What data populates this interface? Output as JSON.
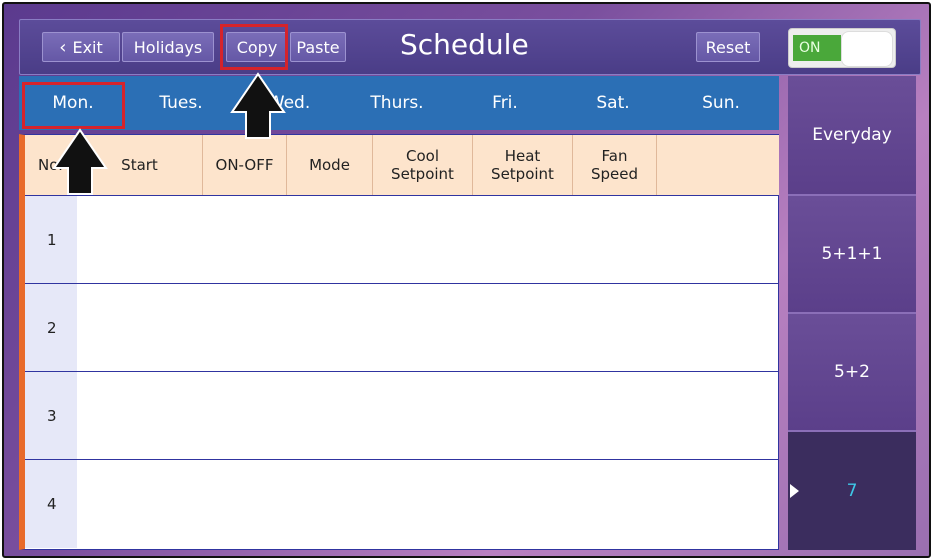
{
  "topbar": {
    "exit_label": "Exit",
    "holidays_label": "Holidays",
    "copy_label": "Copy",
    "paste_label": "Paste",
    "title": "Schedule",
    "reset_label": "Reset",
    "toggle_label": "ON"
  },
  "days": [
    "Mon.",
    "Tues.",
    "Wed.",
    "Thurs.",
    "Fri.",
    "Sat.",
    "Sun."
  ],
  "table": {
    "headers": [
      "No.",
      "Start",
      "ON-OFF",
      "Mode",
      "Cool\nSetpoint",
      "Heat\nSetpoint",
      "Fan\nSpeed",
      ""
    ],
    "rows": [
      "1",
      "2",
      "3",
      "4"
    ]
  },
  "side_modes": [
    "Everyday",
    "5+1+1",
    "5+2",
    "7"
  ],
  "colors": {
    "accent_blue": "#2b6fb5",
    "highlight_red": "#d6232b",
    "active_cyan": "#3ec8e8",
    "toggle_green": "#4aa83a"
  }
}
